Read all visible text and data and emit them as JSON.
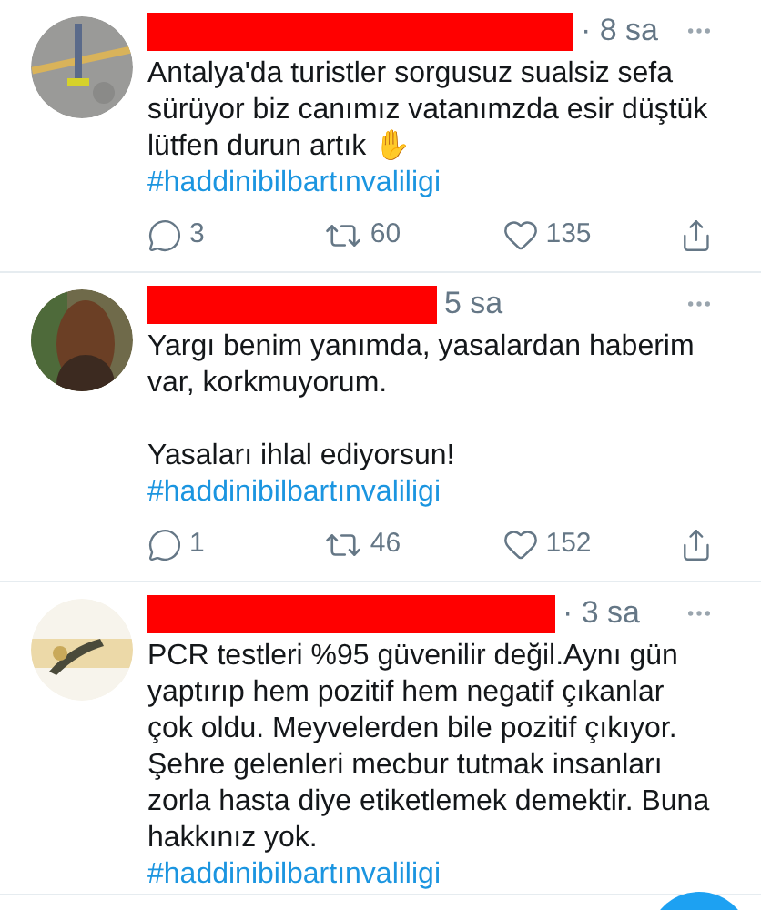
{
  "tweets": [
    {
      "time": "· 8 sa",
      "text": "Antalya'da turistler sorgusuz sualsiz sefa sürüyor biz canımız vatanımzda esir düştük lütfen durun artık ✋",
      "hashtag": "#haddinibilbartınvaliligi",
      "replies": "3",
      "retweets": "60",
      "likes": "135"
    },
    {
      "time": "5 sa",
      "text": "Yargı benim yanımda, yasalardan haberim var, korkmuyorum.\n\nYasaları ihlal ediyorsun!",
      "hashtag": "#haddinibilbartınvaliligi",
      "replies": "1",
      "retweets": "46",
      "likes": "152"
    },
    {
      "time": "· 3 sa",
      "text": "PCR testleri %95 güvenilir değil.Aynı gün yaptırıp hem pozitif hem negatif çıkanlar çok oldu. Meyvelerden bile pozitif çıkıyor. Şehre gelenleri mecbur tutmak insanları zorla hasta diye etiketlemek demektir. Buna hakkınız yok.",
      "hashtag": "#haddinibilbartınvaliligi"
    }
  ]
}
